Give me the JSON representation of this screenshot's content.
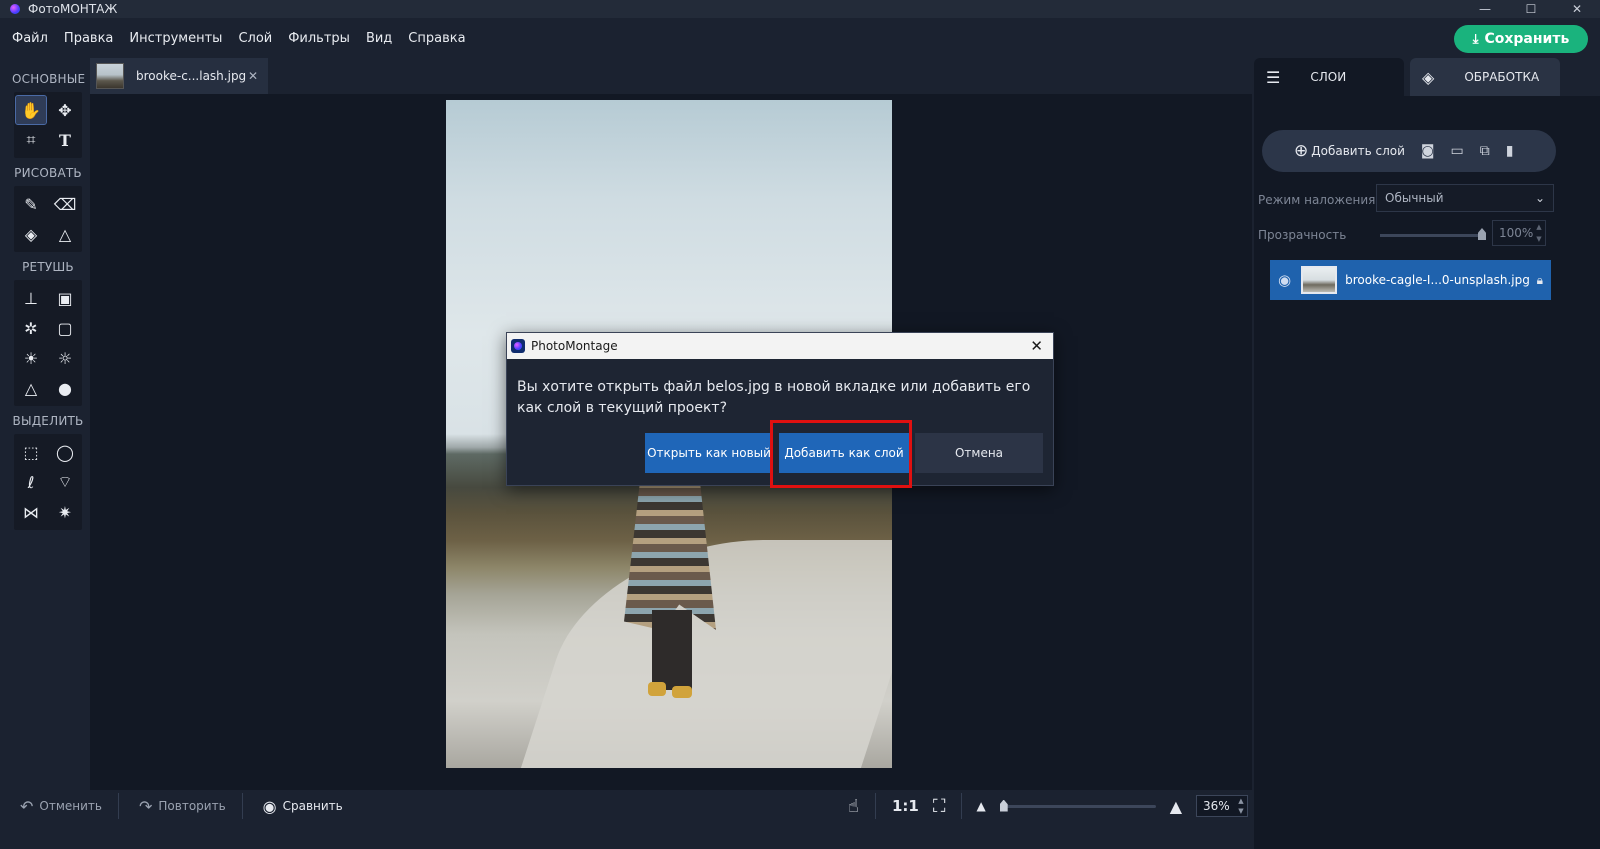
{
  "window": {
    "title": "ФотоМОНТАЖ",
    "minimize": "—",
    "maximize": "☐",
    "close": "✕"
  },
  "menu": [
    "Файл",
    "Правка",
    "Инструменты",
    "Слой",
    "Фильтры",
    "Вид",
    "Справка"
  ],
  "save_button": "Сохранить",
  "toolbox": {
    "sections": [
      "ОСНОВНЫЕ",
      "РИСОВАТЬ",
      "РЕТУШЬ",
      "ВЫДЕЛИТЬ"
    ],
    "basic": [
      "hand-icon",
      "move-icon",
      "crop-icon",
      "text-icon"
    ],
    "draw": [
      "brush-icon",
      "eraser-icon",
      "fill-bucket-icon",
      "shapes-icon"
    ],
    "retouch": [
      "stamp-icon",
      "healing-patch-icon",
      "bandage-icon",
      "frame-icon",
      "brightness-icon",
      "sun-outline-icon",
      "sharpen-triangle-icon",
      "drop-icon"
    ],
    "select": [
      "rect-select-icon",
      "ellipse-select-icon",
      "lasso-icon",
      "polygon-lasso-icon",
      "magnetic-lasso-icon",
      "magic-wand-icon"
    ]
  },
  "document_tab": {
    "name": "brooke-c...lash.jpg",
    "close": "✕"
  },
  "statusbar": {
    "undo": "Отменить",
    "redo": "Повторить",
    "compare": "Сравнить",
    "one_to_one": "1:1",
    "zoom_value": "36%",
    "zoom_level": 0.0
  },
  "right_panel": {
    "tabs": [
      "СЛОИ",
      "ОБРАБОТКА"
    ],
    "add_layer": "Добавить слой",
    "blend_label": "Режим наложения:",
    "blend_value": "Обычный",
    "opacity_label": "Прозрачность",
    "opacity_value": "100%",
    "opacity_level": 1.0,
    "layer_name": "brooke-cagle-I...0-unsplash.jpg"
  },
  "dialog": {
    "title": "PhotoMontage",
    "message": "Вы хотите открыть файл belos.jpg в новой вкладке или добавить его как слой в текущий проект?",
    "buttons": {
      "open_new": "Открыть как новый",
      "add_layer": "Добавить как слой",
      "cancel": "Отмена"
    }
  },
  "colors": {
    "accent_save": "#1ab37d",
    "primary_button": "#1f66b8",
    "selected_layer": "#1f62ad",
    "highlight": "#e01010"
  }
}
